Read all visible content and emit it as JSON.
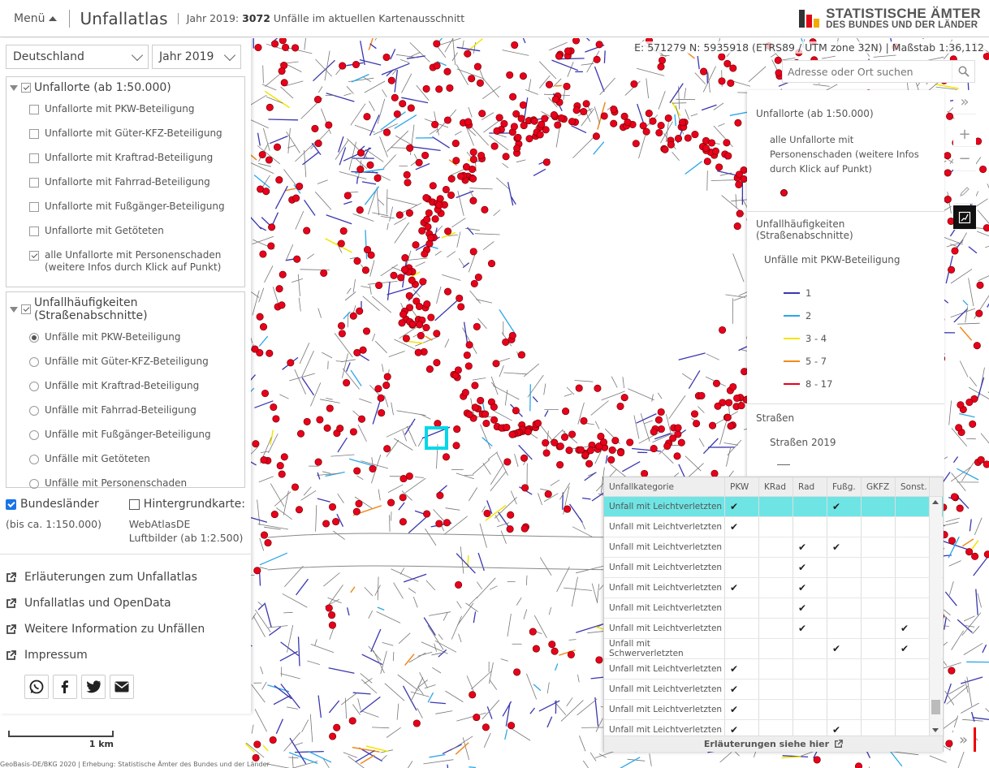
{
  "header": {
    "menu_label": "Menü",
    "app_title": "Unfallatlas",
    "year_prefix": "Jahr 2019:",
    "count": "3072",
    "year_suffix": "Unfälle im aktuellen Kartenausschnitt",
    "logo_line1": "STATISTISCHE ÄMTER",
    "logo_line2": "DES BUNDES UND DER LÄNDER",
    "logo_colors": [
      "#333333",
      "#e30613",
      "#f2a900"
    ]
  },
  "map": {
    "coords": "E: 571279 N: 5935918 (ETRS89 / UTM zone 32N) | Maßstab 1:36,112",
    "search_placeholder": "Adresse oder Ort suchen",
    "scale_label": "1 km",
    "copyright": "GeoBasis-DE/BKG 2020 | Erhebung: Statistische Ämter des Bundes und der Länder",
    "accident_color": "#e8001c"
  },
  "left": {
    "region": "Deutschland",
    "year": "Jahr 2019",
    "group1_title": "Unfallorte (ab 1:50.000)",
    "group1_items": [
      {
        "label": "Unfallorte mit PKW-Beteiligung",
        "checked": false
      },
      {
        "label": "Unfallorte mit Güter-KFZ-Beteiligung",
        "checked": false
      },
      {
        "label": "Unfallorte mit Kraftrad-Beteiligung",
        "checked": false
      },
      {
        "label": "Unfallorte mit Fahrrad-Beteiligung",
        "checked": false
      },
      {
        "label": "Unfallorte mit Fußgänger-Beteiligung",
        "checked": false
      },
      {
        "label": "Unfallorte mit Getöteten",
        "checked": false
      }
    ],
    "group1_last_line1": "alle Unfallorte mit Personenschaden",
    "group1_last_line2": "(weitere Infos durch Klick auf Punkt)",
    "group2_title": "Unfallhäufigkeiten (Straßenabschnitte)",
    "group2_items": [
      {
        "label": "Unfälle mit PKW-Beteiligung",
        "checked": true
      },
      {
        "label": "Unfälle mit Güter-KFZ-Beteiligung",
        "checked": false
      },
      {
        "label": "Unfälle mit Kraftrad-Beteiligung",
        "checked": false
      },
      {
        "label": "Unfälle mit Fahrrad-Beteiligung",
        "checked": false
      },
      {
        "label": "Unfälle mit Fußgänger-Beteiligung",
        "checked": false
      },
      {
        "label": "Unfälle mit Getöteten",
        "checked": false
      },
      {
        "label": "Unfälle mit Personenschaden",
        "checked": false
      }
    ],
    "bundeslaender": "Bundesländer",
    "bundeslaender_sub": "(bis ca. 1:150.000)",
    "hintergrund": "Hintergrundkarte:",
    "hintergrund_sub1": "WebAtlasDE",
    "hintergrund_sub2": "Luftbilder (ab 1:2.500)",
    "links": [
      "Erläuterungen zum Unfallatlas",
      "Unfallatlas und OpenData",
      "Weitere Information zu Unfällen",
      "Impressum"
    ]
  },
  "legend": {
    "sec1_title": "Unfallorte (ab 1:50.000)",
    "sec1_desc1": "alle Unfallorte mit",
    "sec1_desc2": "Personenschaden (weitere Infos",
    "sec1_desc3": "durch Klick auf Punkt)",
    "sec2_title": "Unfallhäufigkeiten (Straßenabschnitte)",
    "sec2_sub": "Unfälle mit PKW-Beteiligung",
    "classes": [
      {
        "label": "1",
        "color": "#3a37b0"
      },
      {
        "label": "2",
        "color": "#2aa7e8"
      },
      {
        "label": "3 - 4",
        "color": "#f2e600"
      },
      {
        "label": "5 - 7",
        "color": "#f08a1c"
      },
      {
        "label": "8 - 17",
        "color": "#e8001c"
      }
    ],
    "sec3_title": "Straßen",
    "sec3_sub": "Straßen 2019"
  },
  "table": {
    "headers": [
      "Unfallkategorie",
      "PKW",
      "KRad",
      "Rad",
      "Fußg.",
      "GKFZ",
      "Sonst."
    ],
    "rows": [
      {
        "kat": "Unfall mit Leichtverletzten",
        "marks": [
          true,
          false,
          false,
          true,
          false,
          false
        ],
        "selected": true
      },
      {
        "kat": "Unfall mit Leichtverletzten",
        "marks": [
          true,
          false,
          false,
          false,
          false,
          false
        ]
      },
      {
        "kat": "Unfall mit Leichtverletzten",
        "marks": [
          false,
          false,
          true,
          true,
          false,
          false
        ]
      },
      {
        "kat": "Unfall mit Leichtverletzten",
        "marks": [
          false,
          false,
          true,
          false,
          false,
          false
        ]
      },
      {
        "kat": "Unfall mit Leichtverletzten",
        "marks": [
          true,
          false,
          true,
          false,
          false,
          false
        ]
      },
      {
        "kat": "Unfall mit Leichtverletzten",
        "marks": [
          false,
          false,
          true,
          false,
          false,
          false
        ]
      },
      {
        "kat": "Unfall mit Leichtverletzten",
        "marks": [
          false,
          false,
          true,
          false,
          false,
          true
        ]
      },
      {
        "kat": "Unfall mit Schwerverletzten",
        "marks": [
          false,
          false,
          false,
          true,
          false,
          true
        ]
      },
      {
        "kat": "Unfall mit Leichtverletzten",
        "marks": [
          true,
          false,
          false,
          false,
          false,
          false
        ]
      },
      {
        "kat": "Unfall mit Leichtverletzten",
        "marks": [
          true,
          false,
          false,
          false,
          false,
          false
        ]
      },
      {
        "kat": "Unfall mit Leichtverletzten",
        "marks": [
          true,
          false,
          false,
          false,
          false,
          false
        ]
      },
      {
        "kat": "Unfall mit Leichtverletzten",
        "marks": [
          true,
          false,
          false,
          true,
          false,
          false
        ]
      }
    ],
    "check_glyph": "✔",
    "footer": "Erläuterungen siehe hier"
  }
}
